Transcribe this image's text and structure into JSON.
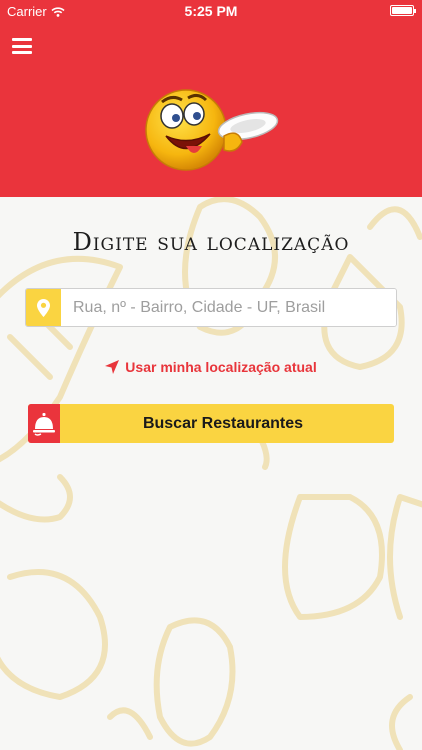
{
  "status_bar": {
    "carrier": "Carrier",
    "time": "5:25 PM"
  },
  "header": {
    "menu_icon": "hamburger-menu-icon",
    "mascot": "smiley-holding-plate",
    "color": "#ea343c"
  },
  "main": {
    "title": "Digite sua localização",
    "search": {
      "placeholder": "Rua, nº - Bairro, Cidade - UF, Brasil",
      "value": "",
      "icon": "map-pin-icon"
    },
    "locate_link": {
      "label": "Usar minha localização atual",
      "icon": "location-arrow-icon"
    },
    "search_button": {
      "label": "Buscar Restaurantes",
      "icon": "service-bell-icon"
    }
  },
  "colors": {
    "primary_red": "#ea343c",
    "accent_yellow": "#fad441",
    "background": "#f7f7f5"
  }
}
